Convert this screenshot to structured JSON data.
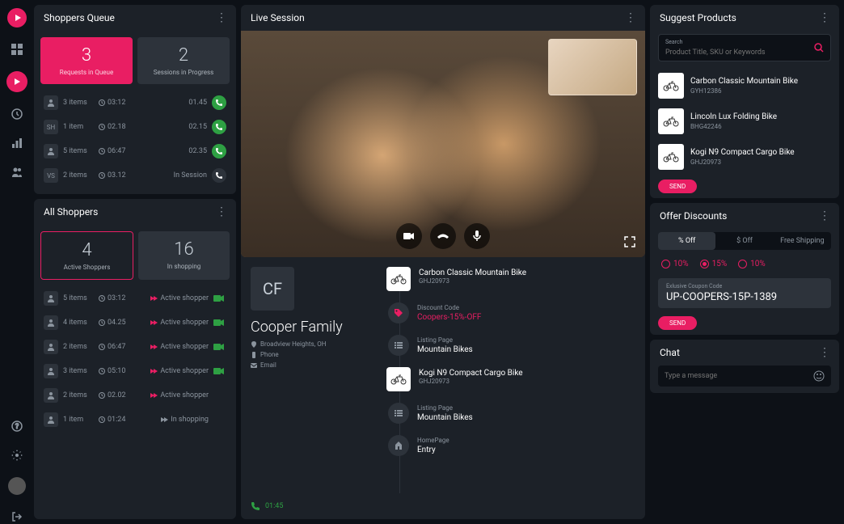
{
  "queue": {
    "title": "Shoppers Queue",
    "stat1_num": "3",
    "stat1_label": "Requests in Queue",
    "stat2_num": "2",
    "stat2_label": "Sessions in Progress",
    "rows": [
      {
        "avatar": "",
        "items": "3 items",
        "time": "03:12",
        "wait": "01.45",
        "status": "call"
      },
      {
        "avatar": "SH",
        "items": "1 item",
        "time": "02.18",
        "wait": "02.15",
        "status": "call"
      },
      {
        "avatar": "",
        "items": "5 items",
        "time": "06:47",
        "wait": "02.35",
        "status": "call"
      },
      {
        "avatar": "VS",
        "items": "2 items",
        "time": "03.12",
        "wait": "In Session",
        "status": "session"
      }
    ]
  },
  "all": {
    "title": "All Shoppers",
    "stat1_num": "4",
    "stat1_label": "Active Shoppers",
    "stat2_num": "16",
    "stat2_label": "In shopping",
    "rows": [
      {
        "items": "5 items",
        "time": "03:12",
        "status": "Active shopper",
        "cam": true
      },
      {
        "items": "4 items",
        "time": "04.25",
        "status": "Active shopper",
        "cam": true
      },
      {
        "items": "2 items",
        "time": "06:47",
        "status": "Active shopper",
        "cam": true
      },
      {
        "items": "3 items",
        "time": "05:10",
        "status": "Active shopper",
        "cam": true
      },
      {
        "items": "2 items",
        "time": "02.02",
        "status": "Active shopper",
        "cam": false
      },
      {
        "items": "1 item",
        "time": "01:24",
        "status": "In shopping",
        "cam": false
      }
    ]
  },
  "live": {
    "title": "Live Session",
    "customer": {
      "initials": "CF",
      "name": "Cooper Family",
      "location": "Broadview Heights, OH",
      "phone": "Phone",
      "email": "Email",
      "call_time": "01:45"
    },
    "timeline": [
      {
        "type": "product",
        "label": "",
        "title": "Carbon Classic Mountain Bike",
        "sub": "GHJ20973"
      },
      {
        "type": "tag",
        "label": "Discount Code",
        "title": "Coopers-15%-OFF",
        "pink": true
      },
      {
        "type": "list",
        "label": "Listing Page",
        "title": "Mountain Bikes"
      },
      {
        "type": "product",
        "label": "",
        "title": "Kogi N9 Compact Cargo Bike",
        "sub": "GHJ20973"
      },
      {
        "type": "list",
        "label": "Listing Page",
        "title": "Mountain Bikes"
      },
      {
        "type": "home",
        "label": "HomePage",
        "title": "Entry"
      }
    ]
  },
  "suggest": {
    "title": "Suggest Products",
    "search_label": "Search",
    "search_placeholder": "Product Title, SKU or Keywords",
    "products": [
      {
        "title": "Carbon Classic Mountain Bike",
        "sku": "GYH12386"
      },
      {
        "title": "Lincoln Lux Folding Bike",
        "sku": "BHG42246"
      },
      {
        "title": "Kogi N9 Compact Cargo Bike",
        "sku": "GHJ20973"
      }
    ],
    "send": "SEND"
  },
  "discount": {
    "title": "Offer Discounts",
    "tabs": [
      "% Off",
      "$ Off",
      "Free Shipping"
    ],
    "options": [
      "10%",
      "15%",
      "10%"
    ],
    "selected": 1,
    "coupon_label": "Exlusive Coupon Code",
    "coupon": "UP-COOPERS-15P-1389",
    "send": "SEND"
  },
  "chat": {
    "title": "Chat",
    "placeholder": "Type a message"
  }
}
